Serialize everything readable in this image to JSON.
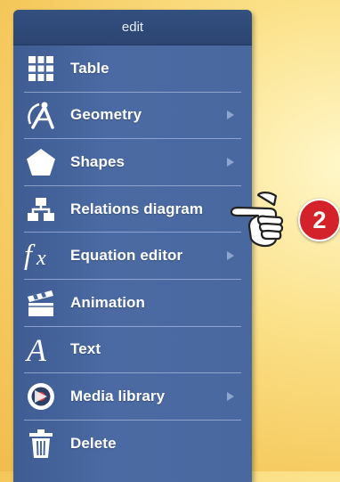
{
  "menu": {
    "title": "edit",
    "items": [
      {
        "label": "Table",
        "icon": "table-icon",
        "submenu": false
      },
      {
        "label": "Geometry",
        "icon": "compass-icon",
        "submenu": true
      },
      {
        "label": "Shapes",
        "icon": "pentagon-icon",
        "submenu": true
      },
      {
        "label": "Relations diagram",
        "icon": "org-chart-icon",
        "submenu": false
      },
      {
        "label": "Equation editor",
        "icon": "fx-icon",
        "submenu": true
      },
      {
        "label": "Animation",
        "icon": "clapperboard-icon",
        "submenu": false
      },
      {
        "label": "Text",
        "icon": "letter-a-icon",
        "submenu": false
      },
      {
        "label": "Media library",
        "icon": "media-play-icon",
        "submenu": true
      },
      {
        "label": "Delete",
        "icon": "trash-icon",
        "submenu": false
      }
    ]
  },
  "callout": {
    "step": "2",
    "icon": "pointing-hand-icon"
  },
  "colors": {
    "menu_bg": "#4a68a0",
    "header_bg": "#2f4878",
    "badge": "#d4222a"
  }
}
